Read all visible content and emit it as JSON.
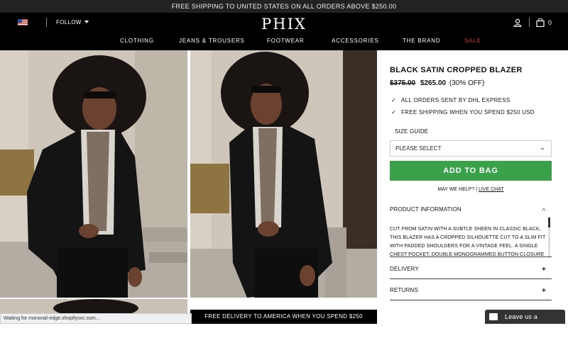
{
  "announcement": "FREE SHIPPING TO UNITED STATES ON ALL ORDERS ABOVE $250.00",
  "header": {
    "follow": "FOLLOW",
    "logo": "PHIX",
    "cart_count": "0"
  },
  "nav": {
    "items": [
      "CLOTHING",
      "JEANS & TROUSERS",
      "FOOTWEAR",
      "ACCESSORIES",
      "THE BRAND",
      "SALE"
    ]
  },
  "product": {
    "title": "BLACK SATIN CROPPED BLAZER",
    "price_old": "$375.00",
    "price_new": "$265.00",
    "discount": "(30% OFF)",
    "perks": [
      "ALL ORDERS SENT BY DHL EXPRESS",
      "FREE SHIPPING WHEN YOU SPEND $250 USD"
    ],
    "size_guide": "SIZE GUIDE",
    "size_select": "PLEASE SELECT",
    "add_to_bag": "ADD TO BAG",
    "help": "MAY WE HELP?",
    "separator": "|",
    "live_chat": "LIVE CHAT",
    "info_heading": "PRODUCT INFORMATION",
    "info_text": "CUT FROM SATIN WITH A SUBTLE SHEEN IN CLASSIC BLACK, THIS BLAZER HAS A CROPPED SILHOUETTE CUT TO A SLIM FIT WITH PADDED SHOULDERS FOR A VINTAGE FEEL. A SINGLE CHEST POCKET, DOUBLE MONOGRAMMED BUTTON CLOSURE AND PEAKED",
    "delivery_heading": "DELIVERY",
    "returns_heading": "RETURNS",
    "collapse_symbol": "˄",
    "expand_symbol": "+"
  },
  "footer_banner": "FREE DELIVERY TO AMERICA WHEN YOU SPEND $250",
  "browser_status": "Waiting for monorail-edge.shopifysvc.com...",
  "chat_widget": "Leave us a Message",
  "colors": {
    "add_to_bag": "#3aa14b",
    "sale": "#d0312d",
    "header_bg": "#000000"
  },
  "icons": [
    "us-flag-icon",
    "chevron-down-icon",
    "user-icon",
    "shopping-bag-icon",
    "check-icon",
    "envelope-icon"
  ]
}
